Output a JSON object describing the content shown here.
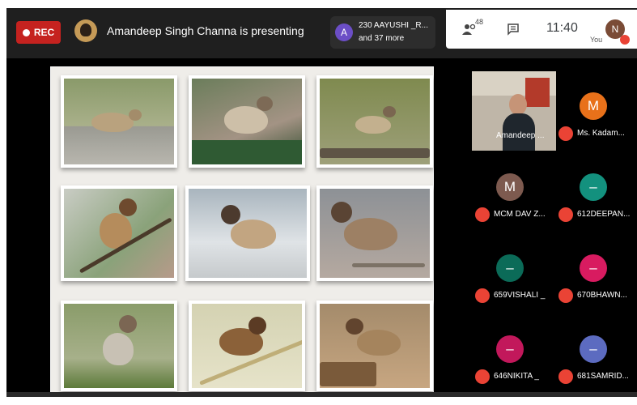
{
  "topbar": {
    "rec_label": "REC",
    "presenting_text": "Amandeep Singh Channa is presenting",
    "viewer_chip": {
      "initial": "A",
      "line1": "230 AAYUSHI _R...",
      "line2": "and 37 more"
    },
    "people_count": "48",
    "clock": "11:40",
    "self": {
      "initial": "N",
      "label": "You"
    }
  },
  "participants": [
    {
      "name": "Amandeep ...",
      "type": "video"
    },
    {
      "name": "Ms. Kadam...",
      "initial": "M",
      "color": "#e8711a"
    },
    {
      "name": "MCM DAV Z...",
      "initial": "M",
      "color": "#7d5a4f"
    },
    {
      "name": "612DEEPAN...",
      "initial": "–",
      "color": "#13917e"
    },
    {
      "name": "659VISHALI _",
      "initial": "–",
      "color": "#0b6b58"
    },
    {
      "name": "670BHAWN...",
      "initial": "–",
      "color": "#d81b60"
    },
    {
      "name": "646NIKITA _",
      "initial": "–",
      "color": "#c2185b"
    },
    {
      "name": "681SAMRID...",
      "initial": "–",
      "color": "#5c6bc0"
    }
  ],
  "colors": {
    "rec": "#c5221f",
    "mute": "#ea4335"
  }
}
